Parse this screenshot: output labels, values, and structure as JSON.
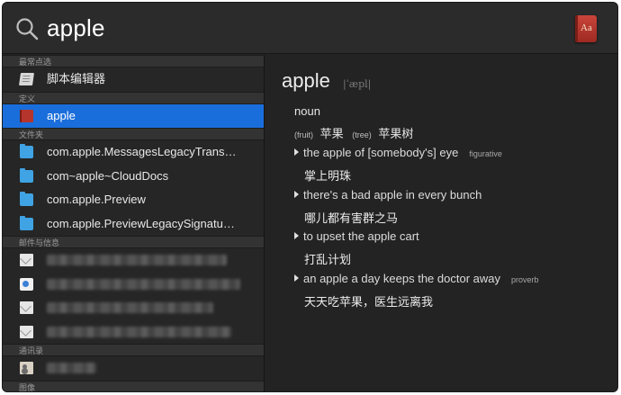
{
  "search": {
    "query": "apple",
    "icon": "magnifier-icon"
  },
  "sections": {
    "top_hit": {
      "header": "最常点选",
      "items": [
        {
          "label": "脚本编辑器",
          "icon": "script-editor-icon"
        }
      ]
    },
    "definition": {
      "header": "定义",
      "items": [
        {
          "label": "apple",
          "icon": "dictionary-icon",
          "selected": true
        }
      ]
    },
    "folders": {
      "header": "文件夹",
      "items": [
        {
          "label": "com.apple.MessagesLegacyTrans…",
          "icon": "folder-icon"
        },
        {
          "label": "com~apple~CloudDocs",
          "icon": "folder-icon"
        },
        {
          "label": "com.apple.Preview",
          "icon": "folder-icon"
        },
        {
          "label": "com.apple.PreviewLegacySignatu…",
          "icon": "folder-icon"
        }
      ]
    },
    "mail": {
      "header": "邮件与信息",
      "items": [
        {
          "icon": "mail-icon"
        },
        {
          "icon": "message-icon"
        },
        {
          "icon": "mail-icon"
        },
        {
          "icon": "mail-icon"
        }
      ]
    },
    "contacts": {
      "header": "通讯录",
      "items": [
        {
          "icon": "contact-card-icon"
        }
      ]
    },
    "more": {
      "header": "图像"
    }
  },
  "definition": {
    "headword": "apple",
    "pronunciation": "|ˈæpl|",
    "part_of_speech": "noun",
    "sense": {
      "tag1": "(fruit)",
      "cn1": "苹果",
      "tag2": "(tree)",
      "cn2": "苹果树"
    },
    "phrases": [
      {
        "en": "the apple of [somebody's] eye",
        "tag": "figurative",
        "cn": "掌上明珠"
      },
      {
        "en": "there's a bad apple in every bunch",
        "tag": "",
        "cn": "哪儿都有害群之马"
      },
      {
        "en": "to upset the apple cart",
        "tag": "",
        "cn": "打乱计划"
      },
      {
        "en": "an apple a day keeps the doctor away",
        "tag": "proverb",
        "cn": "天天吃苹果，医生远离我"
      }
    ]
  },
  "colors": {
    "selection": "#1a6edb",
    "background": "#232323",
    "folder": "#3fa3e4",
    "dictionary": "#b5352c"
  }
}
